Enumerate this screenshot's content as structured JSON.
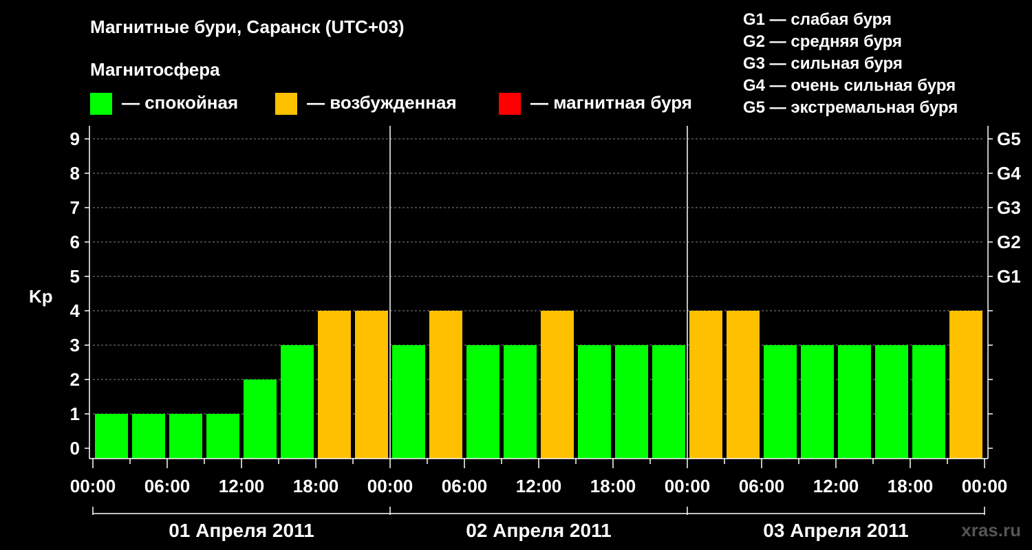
{
  "header": {
    "title": "Магнитные бури, Саранск (UTC+03)",
    "subtitle": "Магнитосфера"
  },
  "legend": [
    {
      "label": "— спокойная",
      "color": "#00ff00"
    },
    {
      "label": "— возбужденная",
      "color": "#ffc000"
    },
    {
      "label": "— магнитная буря",
      "color": "#ff0000"
    }
  ],
  "g_scale": [
    "G1 — слабая буря",
    "G2 — средняя буря",
    "G3 — сильная буря",
    "G4 — очень сильная буря",
    "G5 — экстремальная буря"
  ],
  "watermark": "xras.ru",
  "chart_data": {
    "type": "bar",
    "ylabel": "Kp",
    "ylim": [
      0,
      9
    ],
    "y_ticks": [
      "0",
      "1",
      "2",
      "3",
      "4",
      "5",
      "6",
      "7",
      "8",
      "9"
    ],
    "right_ticks": [
      {
        "kp": 5,
        "label": "G1"
      },
      {
        "kp": 6,
        "label": "G2"
      },
      {
        "kp": 7,
        "label": "G3"
      },
      {
        "kp": 8,
        "label": "G4"
      },
      {
        "kp": 9,
        "label": "G5"
      }
    ],
    "x_tick_labels": [
      "00:00",
      "06:00",
      "12:00",
      "18:00",
      "00:00",
      "06:00",
      "12:00",
      "18:00",
      "00:00",
      "06:00",
      "12:00",
      "18:00",
      "00:00"
    ],
    "days": [
      "01 Апреля 2011",
      "02 Апреля 2011",
      "03 Апреля 2011"
    ],
    "interval_hours": 3,
    "values": [
      1,
      1,
      1,
      1,
      2,
      3,
      4,
      4,
      3,
      4,
      3,
      3,
      4,
      3,
      3,
      3,
      4,
      4,
      3,
      3,
      3,
      3,
      3,
      4
    ],
    "colors": {
      "quiet": "#00ff00",
      "unsettled": "#ffc000",
      "storm": "#ff0000"
    },
    "grid": "dashed"
  }
}
